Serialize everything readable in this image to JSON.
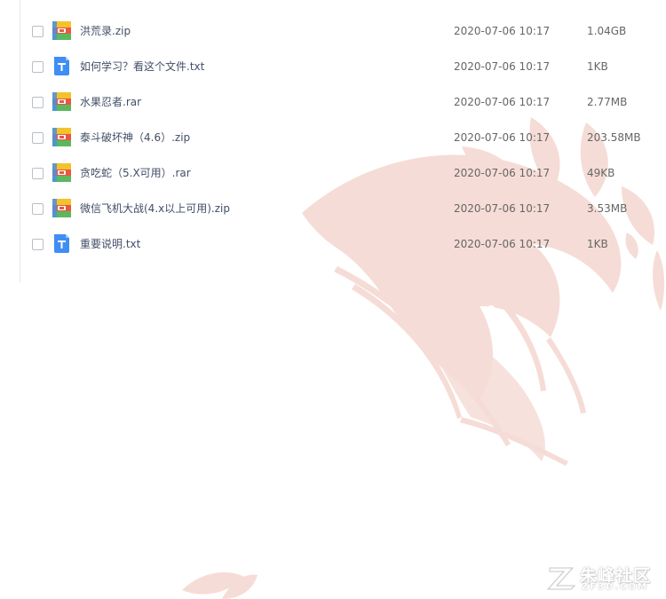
{
  "files": [
    {
      "name": "洪荒录.zip",
      "date": "2020-07-06 10:17",
      "size": "1.04GB",
      "icon": "zip-archive-icon"
    },
    {
      "name": "如何学习？看这个文件.txt",
      "date": "2020-07-06 10:17",
      "size": "1KB",
      "icon": "text-document-icon"
    },
    {
      "name": "水果忍者.rar",
      "date": "2020-07-06 10:17",
      "size": "2.77MB",
      "icon": "zip-archive-icon"
    },
    {
      "name": "泰斗破坏神（4.6）.zip",
      "date": "2020-07-06 10:17",
      "size": "203.58MB",
      "icon": "zip-archive-icon"
    },
    {
      "name": "贪吃蛇（5.X可用）.rar",
      "date": "2020-07-06 10:17",
      "size": "49KB",
      "icon": "zip-archive-icon"
    },
    {
      "name": "微信飞机大战(4.x以上可用).zip",
      "date": "2020-07-06 10:17",
      "size": "3.53MB",
      "icon": "zip-archive-icon"
    },
    {
      "name": "重要说明.txt",
      "date": "2020-07-06 10:17",
      "size": "1KB",
      "icon": "text-document-icon"
    }
  ],
  "logo": {
    "title": "朱峰社区",
    "subtitle": "ZF3D.COM"
  },
  "colors": {
    "watermark": "#f6dcd6",
    "archive_yellow": "#f4c22b",
    "archive_green": "#5cb85c",
    "archive_red": "#e9573f",
    "archive_blue": "#4a90e2",
    "text_doc_blue": "#3f8ef3"
  }
}
